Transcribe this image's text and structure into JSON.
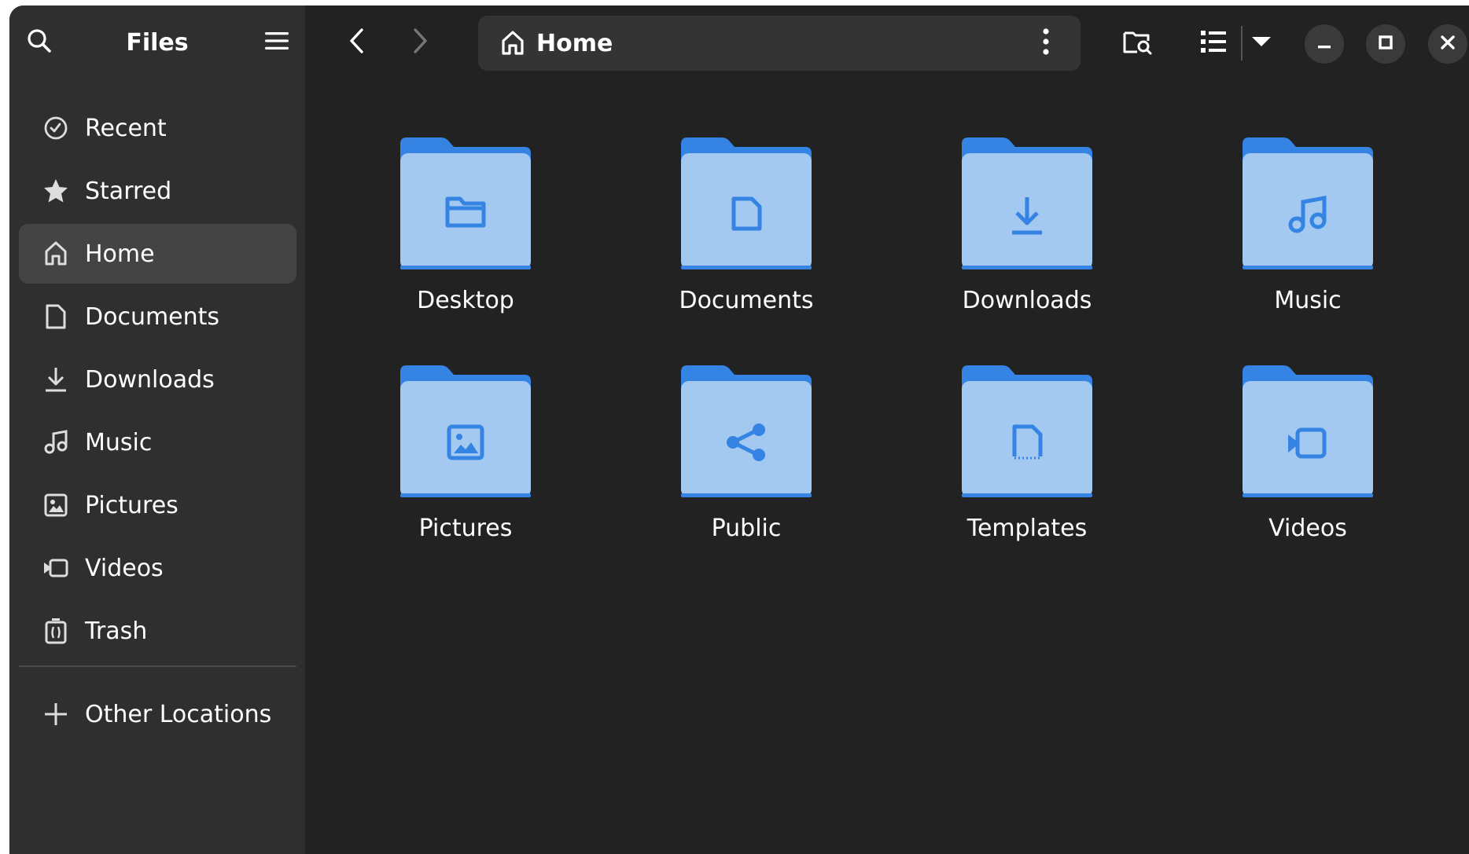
{
  "colors": {
    "window_bg": "#222222",
    "sidebar_bg": "#2f2f2f",
    "folder_back": "#3584e4",
    "folder_front": "#a4c9f1",
    "folder_glyph": "#3584e4",
    "text": "#ffffff"
  },
  "sidebar": {
    "title": "Files",
    "search_icon": "search-icon",
    "menu_icon": "hamburger-menu-icon",
    "items": [
      {
        "label": "Recent",
        "icon": "clock-icon"
      },
      {
        "label": "Starred",
        "icon": "star-icon"
      },
      {
        "label": "Home",
        "icon": "home-icon",
        "active": true
      },
      {
        "label": "Documents",
        "icon": "document-icon"
      },
      {
        "label": "Downloads",
        "icon": "download-icon"
      },
      {
        "label": "Music",
        "icon": "music-icon"
      },
      {
        "label": "Pictures",
        "icon": "image-icon"
      },
      {
        "label": "Videos",
        "icon": "video-icon"
      },
      {
        "label": "Trash",
        "icon": "trash-icon"
      }
    ],
    "other": {
      "label": "Other Locations",
      "icon": "plus-icon"
    }
  },
  "header": {
    "path_label": "Home",
    "back_icon": "chevron-left-icon",
    "forward_icon": "chevron-right-icon",
    "path_menu_icon": "vertical-dots-icon",
    "search_in_folder_icon": "folder-search-icon",
    "view_icon": "list-view-icon",
    "view_options_icon": "dropdown-arrow-icon",
    "minimize_icon": "minimize-icon",
    "maximize_icon": "maximize-icon",
    "close_icon": "close-icon"
  },
  "folders": [
    {
      "name": "Desktop",
      "glyph": "folder-glyph"
    },
    {
      "name": "Documents",
      "glyph": "document-glyph"
    },
    {
      "name": "Downloads",
      "glyph": "download-glyph"
    },
    {
      "name": "Music",
      "glyph": "music-glyph"
    },
    {
      "name": "Pictures",
      "glyph": "image-glyph"
    },
    {
      "name": "Public",
      "glyph": "share-glyph"
    },
    {
      "name": "Templates",
      "glyph": "template-glyph"
    },
    {
      "name": "Videos",
      "glyph": "video-glyph"
    }
  ]
}
